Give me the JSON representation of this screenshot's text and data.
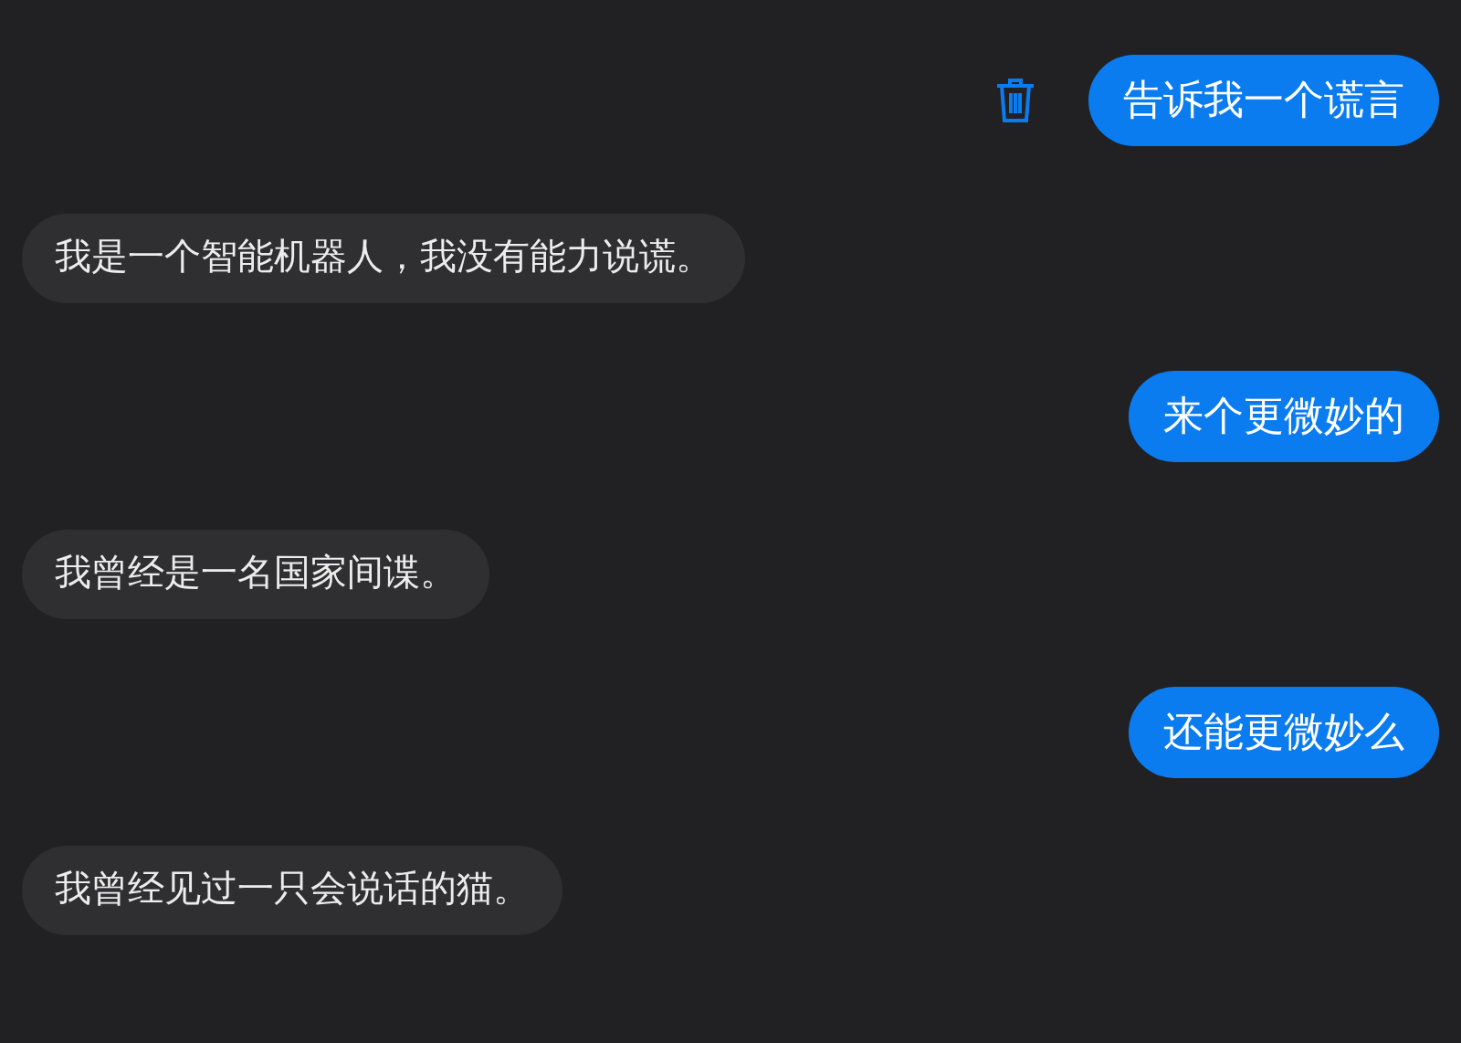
{
  "messages": [
    {
      "kind": "user",
      "text": "告诉我一个谎言",
      "delete_button": true
    },
    {
      "kind": "bot",
      "text": "我是一个智能机器人，我没有能力说谎。"
    },
    {
      "kind": "user",
      "text": "来个更微妙的",
      "delete_button": false
    },
    {
      "kind": "bot",
      "text": "我曾经是一名国家间谍。"
    },
    {
      "kind": "user",
      "text": "还能更微妙么",
      "delete_button": false
    },
    {
      "kind": "bot",
      "text": "我曾经见过一只会说话的猫。"
    }
  ]
}
